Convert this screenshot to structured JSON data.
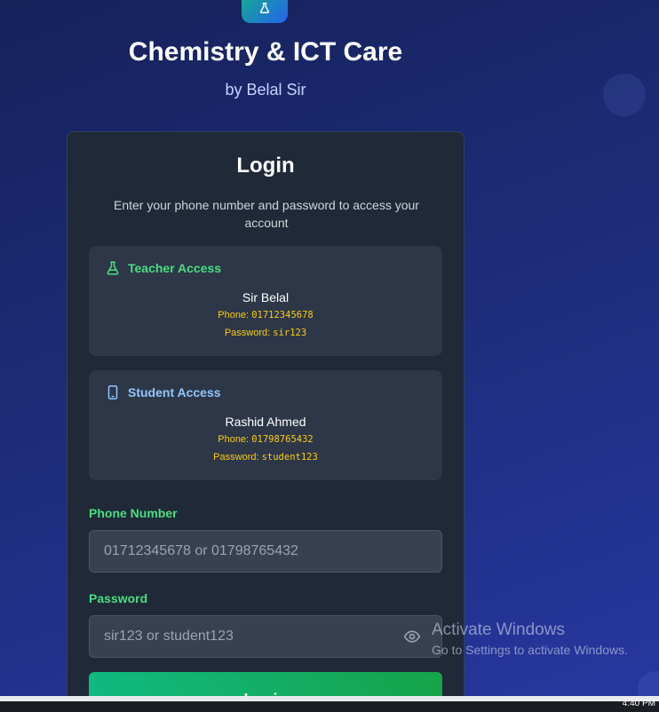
{
  "app": {
    "title": "Chemistry & ICT Care",
    "subtitle": "by Belal Sir"
  },
  "login": {
    "title": "Login",
    "description": "Enter your phone number and password to access your account",
    "teacher": {
      "heading": "Teacher Access",
      "name": "Sir Belal",
      "phone_label": "Phone:",
      "phone": "01712345678",
      "password_label": "Password:",
      "password": "sir123",
      "icon": "flask-icon",
      "color": "#4ade80"
    },
    "student": {
      "heading": "Student Access",
      "name": "Rashid Ahmed",
      "phone_label": "Phone:",
      "phone": "01798765432",
      "password_label": "Password:",
      "password": "student123",
      "icon": "phone-icon",
      "color": "#93c5fd"
    },
    "phone_field": {
      "label": "Phone Number",
      "placeholder": "01712345678 or 01798765432",
      "value": ""
    },
    "password_field": {
      "label": "Password",
      "placeholder": "sir123 or student123",
      "value": ""
    },
    "submit_label": "Login"
  },
  "watermark": {
    "title": "Activate Windows",
    "subtitle": "Go to Settings to activate Windows."
  },
  "taskbar": {
    "clock": "4:40 PM"
  },
  "colors": {
    "accent": "#10b981",
    "card": "#1f2937",
    "highlight": "#facc15"
  }
}
